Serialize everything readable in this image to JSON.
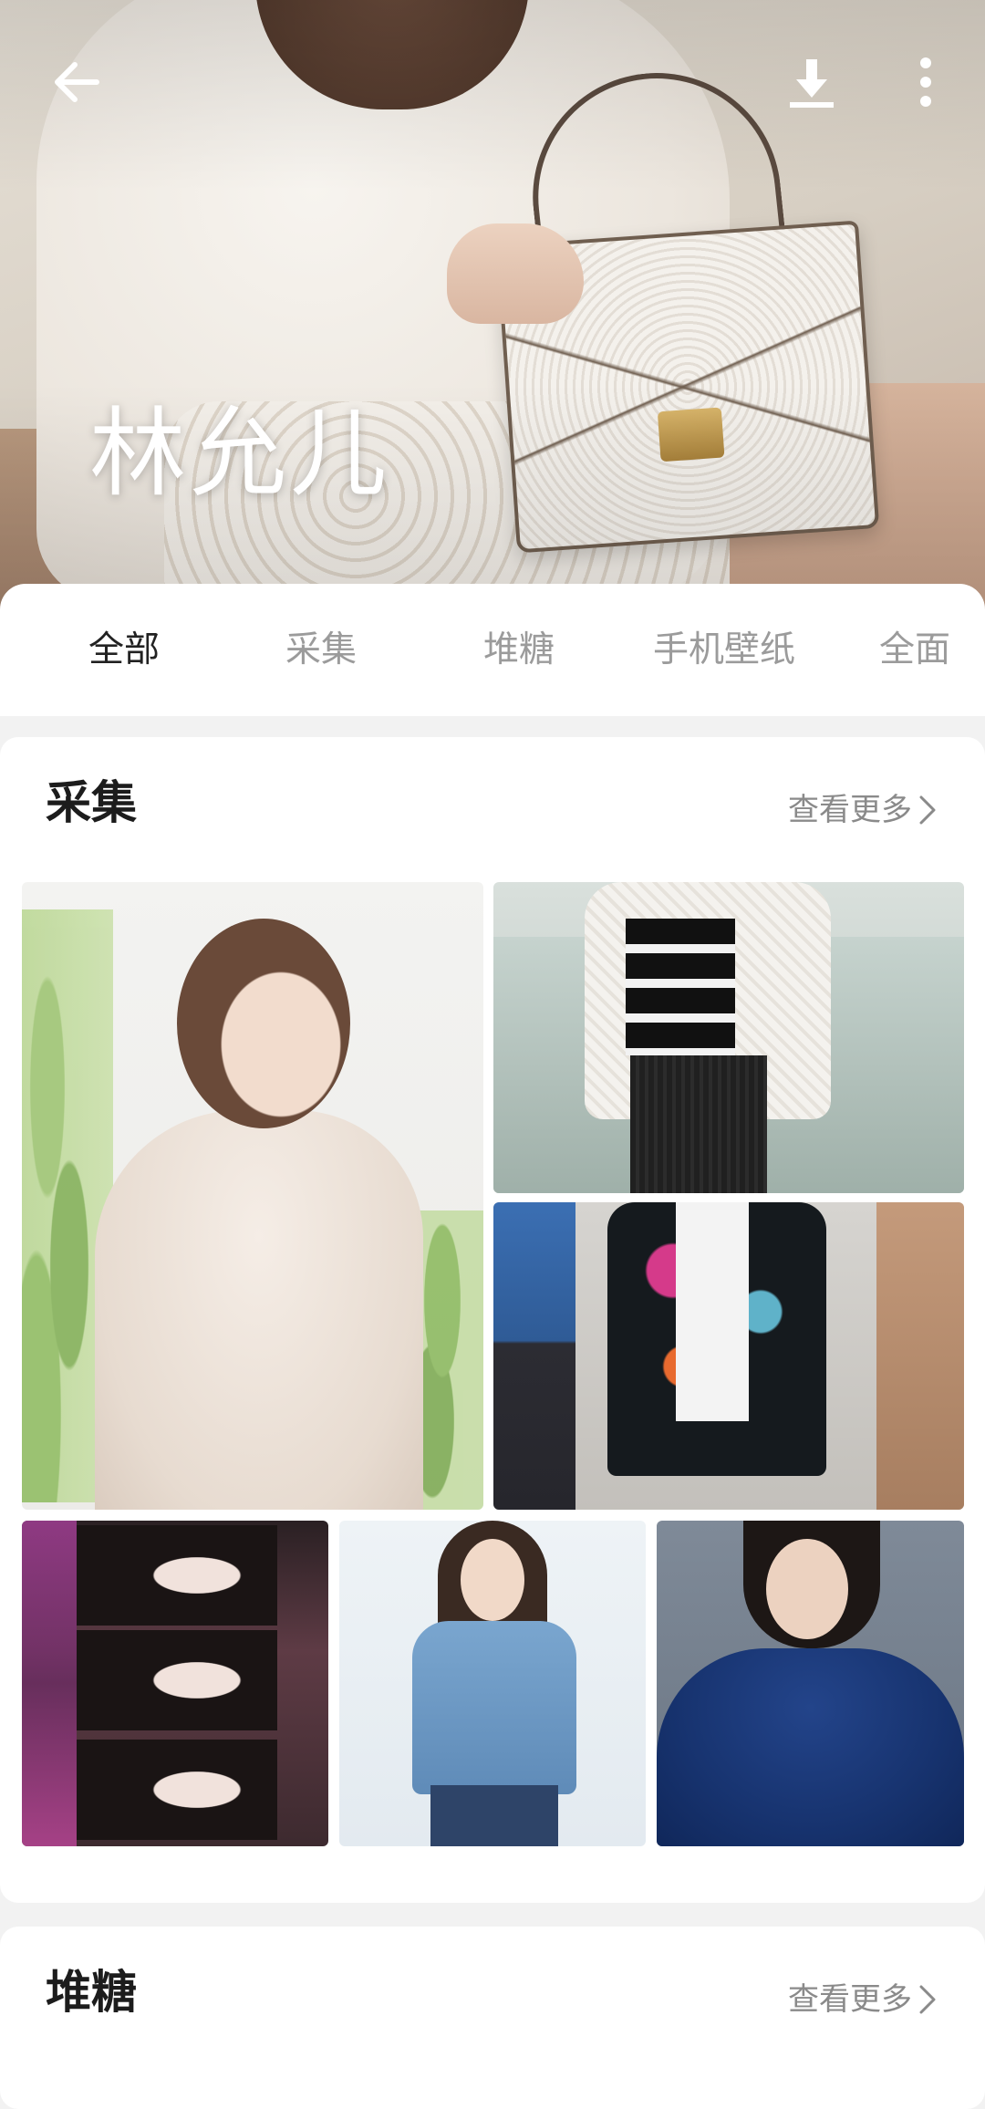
{
  "header": {
    "back_icon": "arrow-left-icon",
    "download_icon": "download-icon",
    "more_icon": "more-vertical-icon",
    "title": "林允儿"
  },
  "tabs": [
    {
      "label": "全部",
      "active": true
    },
    {
      "label": "采集",
      "active": false
    },
    {
      "label": "堆糖",
      "active": false
    },
    {
      "label": "手机壁纸",
      "active": false
    },
    {
      "label": "全面",
      "active": false
    }
  ],
  "sections": [
    {
      "title": "采集",
      "more_label": "查看更多"
    },
    {
      "title": "堆糖",
      "more_label": "查看更多"
    }
  ],
  "colors": {
    "active_tab": "#222222",
    "inactive_tab": "#9b9b9b",
    "more_link": "#8a8a8a",
    "page_bg": "#f2f2f2"
  }
}
